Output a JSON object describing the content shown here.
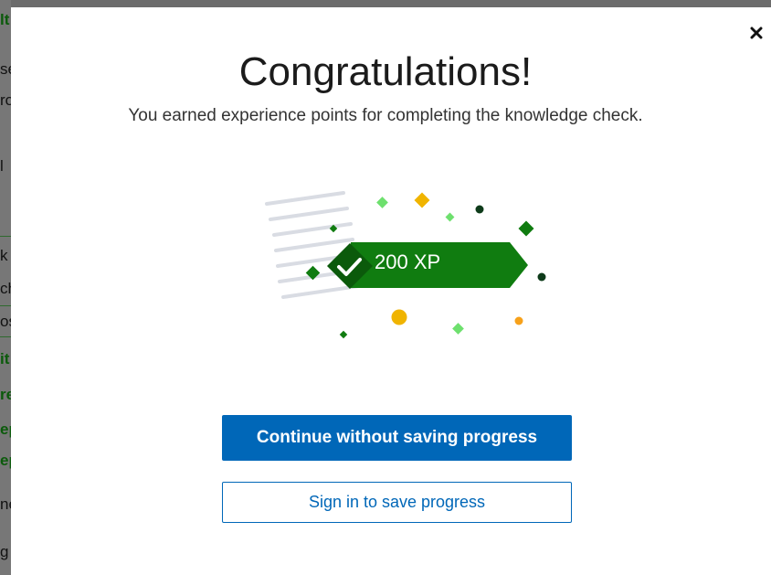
{
  "background": {
    "fragments": [
      {
        "text": "lt",
        "style": "green"
      },
      {
        "text": "se",
        "style": ""
      },
      {
        "text": "ro",
        "style": ""
      },
      {
        "text": "l",
        "style": ""
      },
      {
        "text": "k",
        "style": ""
      },
      {
        "text": "ch",
        "style": ""
      },
      {
        "text": "os",
        "style": ""
      },
      {
        "text": "it",
        "style": "green"
      },
      {
        "text": "re",
        "style": "green"
      },
      {
        "text": "ep",
        "style": "green"
      },
      {
        "text": "ep",
        "style": "green"
      },
      {
        "text": "ne",
        "style": ""
      },
      {
        "text": "g",
        "style": ""
      }
    ]
  },
  "dialog": {
    "close_icon": "close-icon",
    "title": "Congratulations!",
    "subtitle": "You earned experience points for completing the knowledge check.",
    "badge": {
      "icon": "checkmark-icon",
      "xp_label": "200 XP"
    },
    "primary_button": "Continue without saving progress",
    "secondary_button": "Sign in to save progress"
  },
  "colors": {
    "badge_green": "#107c10",
    "badge_dark_green": "#0b5a0b",
    "primary_blue": "#0067b8",
    "confetti_gold": "#f0b400",
    "confetti_orange": "#f7a11a",
    "confetti_light_green": "#6ee06e",
    "confetti_dark": "#0e3b1a"
  }
}
